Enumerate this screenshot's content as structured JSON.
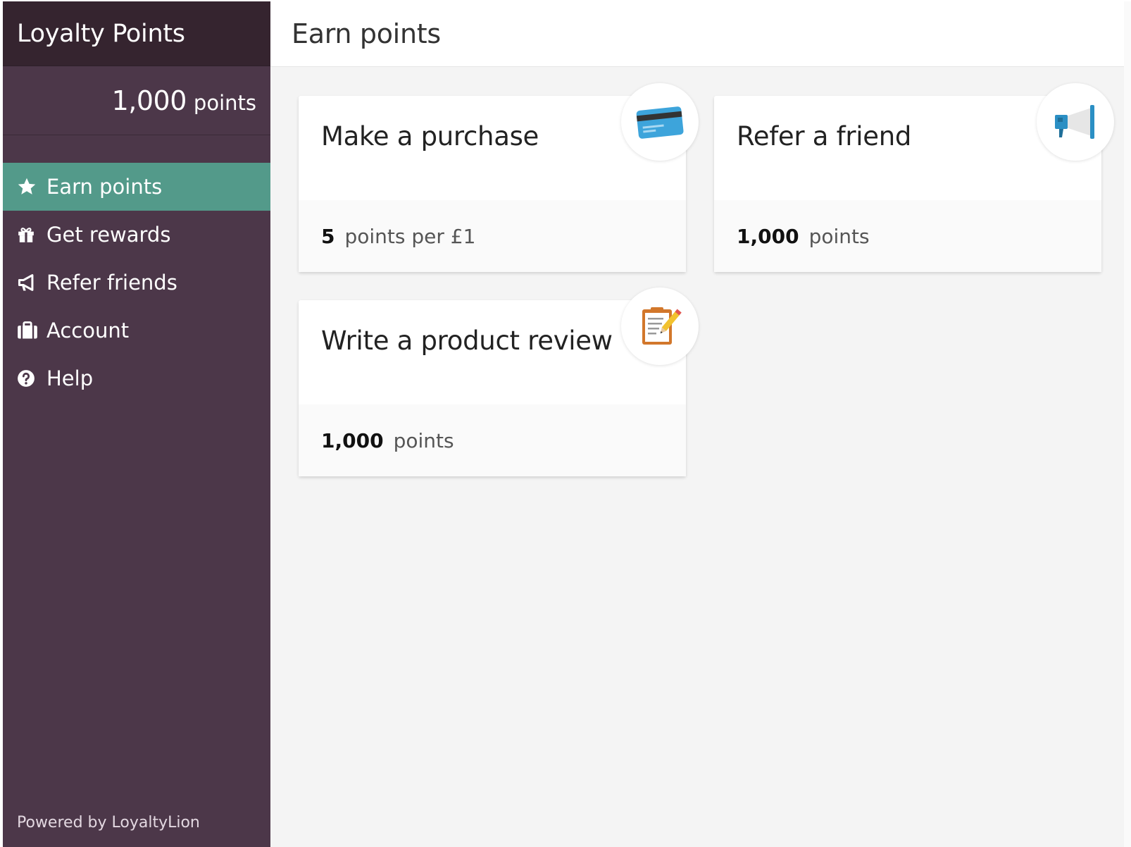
{
  "sidebar": {
    "title": "Loyalty Points",
    "points_value": "1,000",
    "points_unit": "points",
    "items": [
      {
        "label": "Earn points",
        "icon": "star-icon",
        "active": true
      },
      {
        "label": "Get rewards",
        "icon": "gift-icon",
        "active": false
      },
      {
        "label": "Refer friends",
        "icon": "megaphone-icon",
        "active": false
      },
      {
        "label": "Account",
        "icon": "briefcase-icon",
        "active": false
      },
      {
        "label": "Help",
        "icon": "question-circle-icon",
        "active": false
      }
    ],
    "footer": "Powered by LoyaltyLion"
  },
  "main": {
    "title": "Earn points",
    "cards": [
      {
        "title": "Make a purchase",
        "value": "5",
        "text": "points per £1",
        "icon": "credit-card-icon"
      },
      {
        "title": "Refer a friend",
        "value": "1,000",
        "text": "points",
        "icon": "megaphone-icon"
      },
      {
        "title": "Write a product review",
        "value": "1,000",
        "text": "points",
        "icon": "clipboard-pencil-icon"
      }
    ]
  },
  "colors": {
    "sidebar_bg": "#4c3749",
    "sidebar_header_bg": "#35242f",
    "active_item_bg": "#539a8a",
    "main_bg": "#f4f4f4"
  }
}
